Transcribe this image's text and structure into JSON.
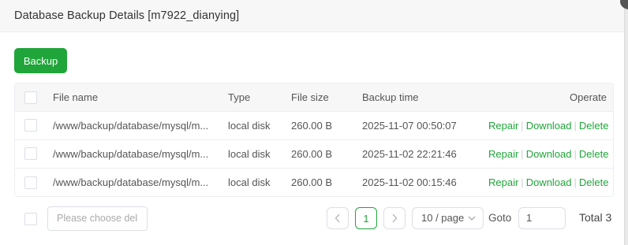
{
  "dialog": {
    "title": "Database Backup Details [m7922_dianying]"
  },
  "toolbar": {
    "backup_label": "Backup"
  },
  "table": {
    "columns": {
      "file_name": "File name",
      "type": "Type",
      "file_size": "File size",
      "backup_time": "Backup time",
      "operate": "Operate"
    },
    "rows": [
      {
        "file_name": "/www/backup/database/mysql/m...",
        "type": "local disk",
        "file_size": "260.00 B",
        "backup_time": "2025-11-07 00:50:07"
      },
      {
        "file_name": "/www/backup/database/mysql/m...",
        "type": "local disk",
        "file_size": "260.00 B",
        "backup_time": "2025-11-02 22:21:46"
      },
      {
        "file_name": "/www/backup/database/mysql/m...",
        "type": "local disk",
        "file_size": "260.00 B",
        "backup_time": "2025-11-02 00:15:46"
      }
    ],
    "operations": {
      "repair": "Repair",
      "download": "Download",
      "delete": "Delete",
      "separator": "|"
    }
  },
  "footer": {
    "batch_placeholder": "Please choose del",
    "current_page": "1",
    "page_size": "10 / page",
    "goto_label": "Goto",
    "goto_value": "1",
    "total": "Total 3"
  },
  "colors": {
    "accent": "#20a53a"
  }
}
